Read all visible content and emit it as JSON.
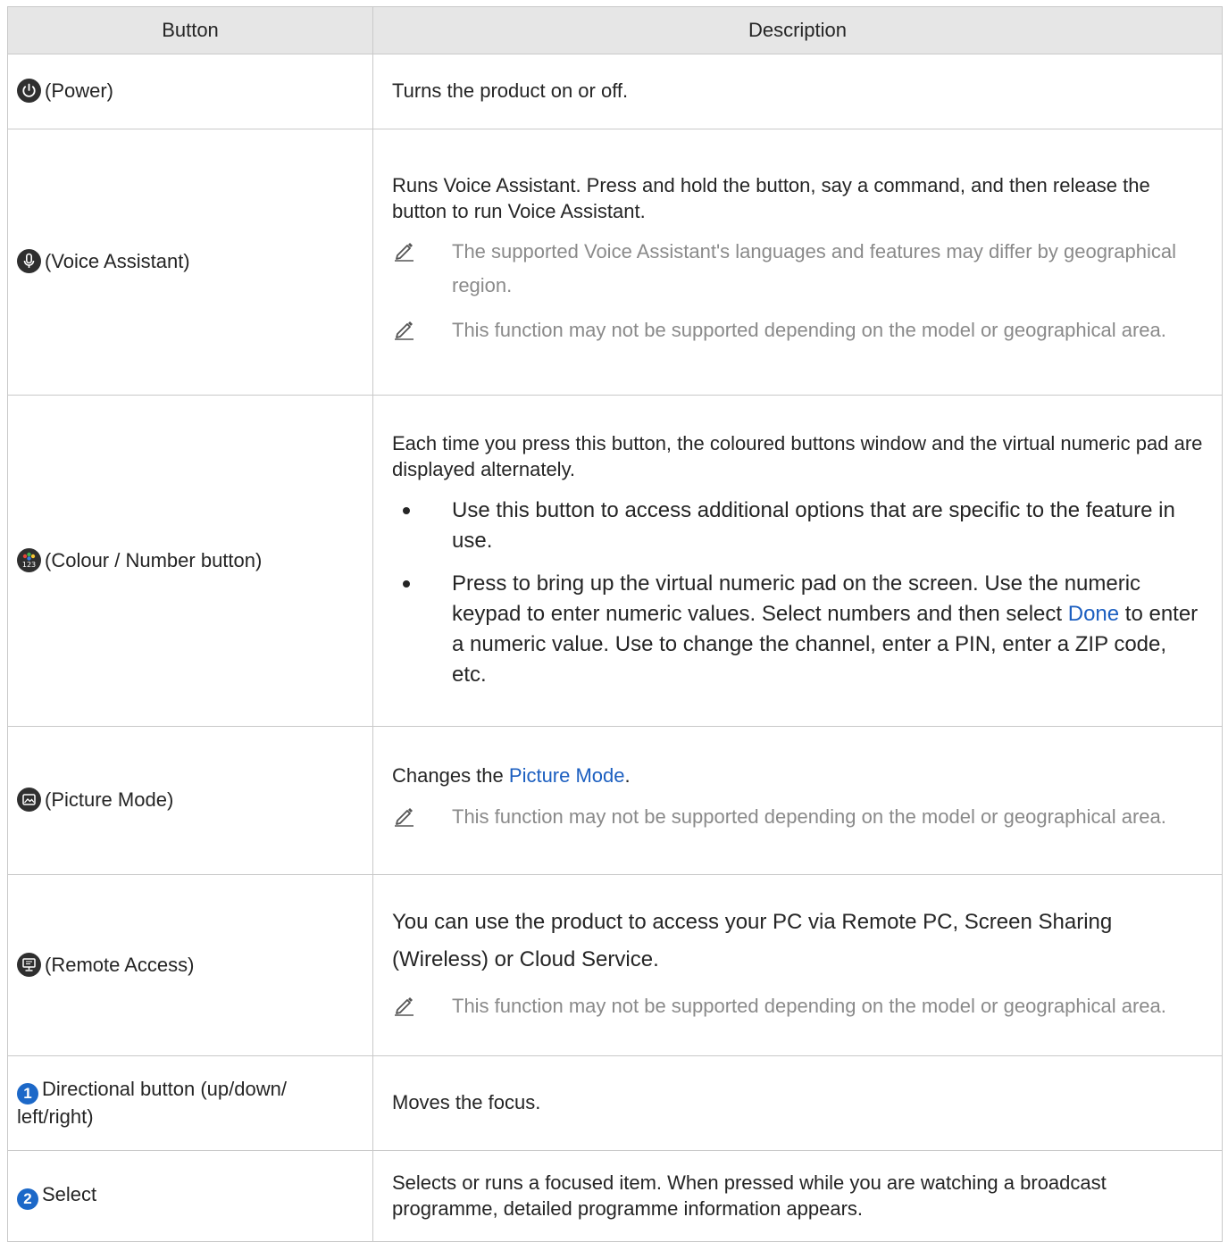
{
  "header": {
    "col1": "Button",
    "col2": "Description"
  },
  "rows": [
    {
      "icon": "power-icon",
      "label": "(Power)",
      "desc": "Turns the product on or off."
    },
    {
      "icon": "microphone-icon",
      "label": "(Voice Assistant)",
      "desc": "Runs Voice Assistant. Press and hold the button, say a command, and then release the button to run Voice Assistant.",
      "notes": [
        "The supported Voice Assistant's languages and features may differ by geographical region.",
        "This function may not be supported depending on the model or geographical area."
      ]
    },
    {
      "icon": "color-number-icon",
      "label": "(Colour / Number button)",
      "desc": "Each time you press this button, the coloured buttons window and the virtual numeric pad are displayed alternately.",
      "bullets": [
        "Use this button to access additional options that are specific to the feature in use.",
        "Press to bring up the virtual numeric pad on the screen. Use the numeric keypad to enter numeric values. Select numbers and then select",
        "Done",
        "to enter a numeric value. Use to change the channel, enter a PIN, enter a ZIP code, etc."
      ]
    },
    {
      "icon": "picture-mode-icon",
      "label": "(Picture Mode)",
      "desc_prefix": "Changes the",
      "desc_link": "Picture Mode",
      "desc_suffix": ".",
      "notes": [
        "This function may not be supported depending on the model or geographical area."
      ]
    },
    {
      "icon": "remote-access-icon",
      "label": "(Remote Access)",
      "desc": "You can use the product to access your PC via Remote PC, Screen Sharing (Wireless) or Cloud Service.",
      "notes": [
        "This function may not be supported depending on the model or geographical area."
      ]
    },
    {
      "num": "1",
      "label": "Directional button (up/down/ left/right)",
      "desc": "Moves the focus."
    },
    {
      "num": "2",
      "label": "Select",
      "desc": "Selects or runs a focused item. When pressed while you are watching a broadcast programme, detailed programme information appears."
    }
  ]
}
